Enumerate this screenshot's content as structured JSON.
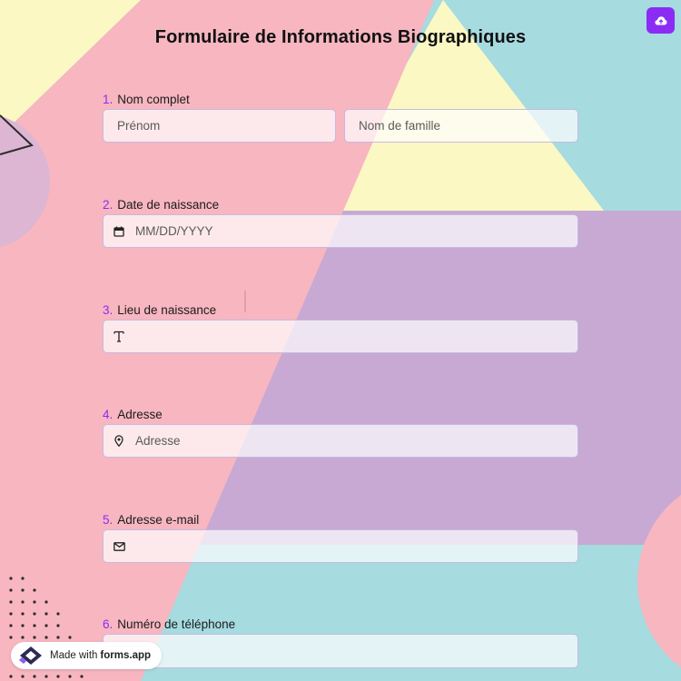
{
  "header": {
    "title": "Formulaire de Informations Biographiques"
  },
  "questions": [
    {
      "number": "1.",
      "label": "Nom complet",
      "first_placeholder": "Prénom",
      "last_placeholder": "Nom de famille"
    },
    {
      "number": "2.",
      "label": "Date de naissance",
      "placeholder": "MM/DD/YYYY",
      "icon": "calendar-icon"
    },
    {
      "number": "3.",
      "label": "Lieu de naissance",
      "placeholder": "",
      "icon": "text-icon"
    },
    {
      "number": "4.",
      "label": "Adresse",
      "placeholder": "Adresse",
      "icon": "location-pin-icon"
    },
    {
      "number": "5.",
      "label": "Adresse e-mail",
      "placeholder": "",
      "icon": "envelope-icon"
    },
    {
      "number": "6.",
      "label": "Numéro de téléphone",
      "placeholder": ""
    }
  ],
  "footer": {
    "made_with": "Made with",
    "brand": "forms.app"
  },
  "colors": {
    "accent": "#8b2cf5",
    "bg_teal": "#a6dbe0",
    "bg_pink": "#f7b6c0",
    "bg_yellow": "#fbf8c4",
    "bg_lavender": "#c7a9d3"
  }
}
